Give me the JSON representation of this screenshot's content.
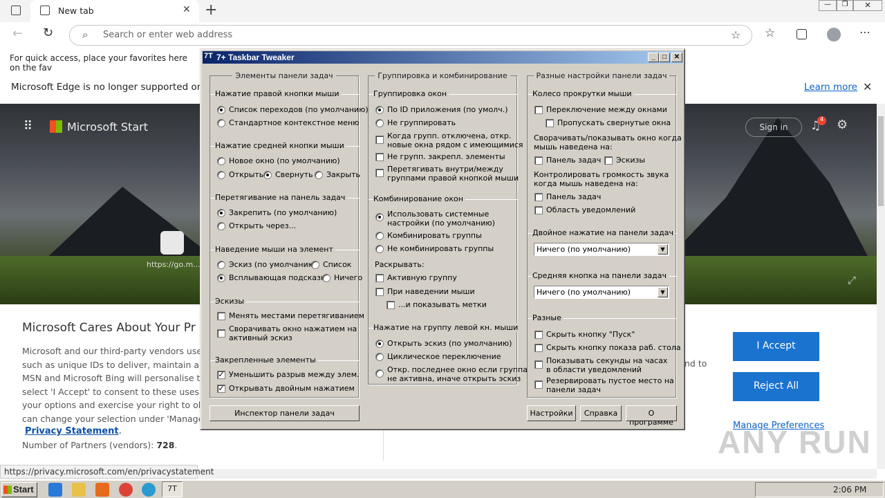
{
  "browser": {
    "tab_title": "New tab",
    "address_placeholder": "Search or enter web address",
    "fav_hint": "For quick access, place your favorites here on the fav",
    "info_text": "Microsoft Edge is no longer supported on this",
    "learn_more": "Learn more"
  },
  "page": {
    "brand": "Microsoft Start",
    "sign_in": "Sign in",
    "notif_count": "4",
    "tile_label": "https://go.m...",
    "heading": "Microsoft Cares About Your Pr",
    "body_lines": [
      "Microsoft and our third-party vendors use c",
      "such as unique IDs to deliver, maintain and in",
      "MSN and Microsoft Bing will personalise the",
      "select 'I Accept' to consent to these uses or",
      "your options and exercise your right to obje",
      "can change your selection under 'Manage P"
    ],
    "privacy_link": "Privacy Statement",
    "privacy_suffix": ".",
    "partners_label": "Number of Partners (vendors): ",
    "partners_count": "728",
    "partners_suffix": ".",
    "right_fragment": "nd to",
    "accept": "I Accept",
    "reject": "Reject All",
    "manage": "Manage Preferences"
  },
  "status_url": "https://privacy.microsoft.com/en/privacystatement",
  "watermark": "ANY RUN",
  "taskbar": {
    "start": "Start",
    "clock": "2:06 PM"
  },
  "dialog": {
    "title": "7+ Taskbar Tweaker",
    "col1": {
      "title": "Элементы панели задач",
      "s1": "Нажатие правой кнопки мыши",
      "s1_o1": "Список переходов (по умолчанию)",
      "s1_o2": "Стандартное контекстное меню",
      "s2": "Нажатие средней кнопки мыши",
      "s2_o1": "Новое окно (по умолчанию)",
      "s2_o2": "Открыть",
      "s2_o3": "Свернуть",
      "s2_o4": "Закрыть",
      "s3": "Перетягивание на панель задач",
      "s3_o1": "Закрепить (по умолчанию)",
      "s3_o2": "Открыть через...",
      "s4": "Наведение мыши на элемент",
      "s4_o1": "Эскиз (по умолчанию)",
      "s4_o2": "Список",
      "s4_o3": "Всплывающая подсказка",
      "s4_o4": "Ничего",
      "s5": "Эскизы",
      "s5_c1": "Менять местами перетягиванием",
      "s5_c2a": "Сворачивать окно нажатием на",
      "s5_c2b": "активный эскиз",
      "s6": "Закрепленные элементы",
      "s6_c1": "Уменьшить разрыв между элем.",
      "s6_c2": "Открывать двойным нажатием"
    },
    "col2": {
      "title": "Группировка и комбинирование",
      "s1": "Группировка окон",
      "s1_o1": "По ID приложения (по умолч.)",
      "s1_o2": "Не группировать",
      "s1_c1a": "Когда групп. отключена, откр.",
      "s1_c1b": "новые окна рядом с имеющимися",
      "s1_c2": "Не групп. закрепл. элементы",
      "s1_c3a": "Перетягивать внутри/между",
      "s1_c3b": "группами правой кнопкой мыши",
      "s2": "Комбинирование окон",
      "s2_o1a": "Использовать системные",
      "s2_o1b": "настройки (по умолчанию)",
      "s2_o2": "Комбинировать группы",
      "s2_o3": "Не комбинировать группы",
      "s2_exp": "Раскрывать:",
      "s2_c1": "Активную группу",
      "s2_c2": "При наведении мыши",
      "s2_c3": "...и показывать метки",
      "s3": "Нажатие на группу левой кн. мыши",
      "s3_o1": "Открыть эскиз (по умолчанию)",
      "s3_o2": "Циклическое переключение",
      "s3_o3a": "Откр. последнее окно если группа",
      "s3_o3b": "не активна, иначе открыть эскиз"
    },
    "col3": {
      "title": "Разные настройки панели задач",
      "s1": "Колесо прокрутки мыши",
      "s1_c1": "Переключение между окнами",
      "s1_c2": "Пропускать свернутые окна",
      "s1_t1a": "Сворачивать/показывать окно когда",
      "s1_t1b": "мышь наведена на:",
      "s1_c3": "Панель задач",
      "s1_c4": "Эскизы",
      "s1_t2a": "Контролировать громкость звука",
      "s1_t2b": "когда мышь наведена на:",
      "s1_c5": "Панель задач",
      "s1_c6": "Область уведомлений",
      "s2": "Двойное нажатие на панели задач",
      "s2_val": "Ничего (по умолчанию)",
      "s3": "Средняя кнопка на панели задач",
      "s3_val": "Ничего (по умолчанию)",
      "s4": "Разные",
      "s4_c1": "Скрыть кнопку \"Пуск\"",
      "s4_c2": "Скрыть кнопку показа раб. стола",
      "s4_c3a": "Показывать секунды на часах",
      "s4_c3b": "в области уведомлений",
      "s4_c4a": "Резервировать пустое место на",
      "s4_c4b": "панели задач"
    },
    "btn_inspector": "Инспектор панели задач",
    "btn_settings": "Настройки",
    "btn_help": "Справка",
    "btn_about": "О программе"
  }
}
